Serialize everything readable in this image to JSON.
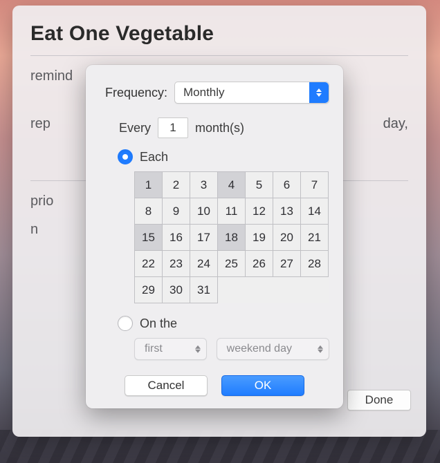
{
  "background": {
    "title": "Eat One Vegetable",
    "rows": {
      "remind_label": "remind",
      "repeat_label": "rep",
      "repeat_value_fragment": "day,",
      "priority_label": "prio",
      "notes_label": "n"
    },
    "done_button": "Done"
  },
  "popover": {
    "frequency_label": "Frequency:",
    "frequency_value": "Monthly",
    "every_label": "Every",
    "every_value": "1",
    "every_unit": "month(s)",
    "each_label": "Each",
    "each_selected": true,
    "days": [
      [
        1,
        2,
        3,
        4,
        5,
        6,
        7
      ],
      [
        8,
        9,
        10,
        11,
        12,
        13,
        14
      ],
      [
        15,
        16,
        17,
        18,
        19,
        20,
        21
      ],
      [
        22,
        23,
        24,
        25,
        26,
        27,
        28
      ],
      [
        29,
        30,
        31,
        null,
        null,
        null,
        null
      ]
    ],
    "days_selected": [
      1,
      4,
      15,
      18
    ],
    "onthe_label": "On the",
    "onthe_selected": false,
    "ordinal_value": "first",
    "dayofweek_value": "weekend day",
    "cancel": "Cancel",
    "ok": "OK"
  }
}
